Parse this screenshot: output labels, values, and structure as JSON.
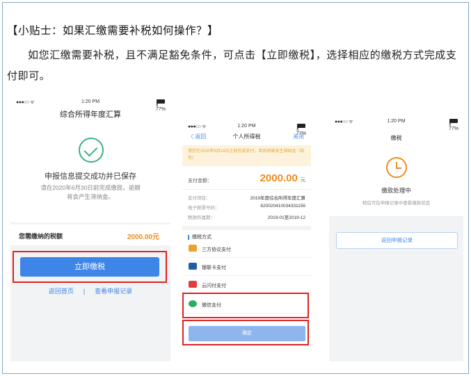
{
  "tip": {
    "title": "【小贴士：如果汇缴需要补税如何操作？】",
    "body": "如您汇缴需要补税，且不满足豁免条件，可点击【立即缴税】，选择相应的缴税方式完成支付即可。"
  },
  "status_bar": {
    "signal": "●●●○○ ᯤ",
    "time": "1:20 PM",
    "battery": "∦ 77%"
  },
  "screen1": {
    "title": "综合所得年度汇算",
    "success_title": "申报信息提交成功并已保存",
    "success_sub": "请在2020年6月30日前完成缴款，逾期将会产生滞纳金。",
    "tax_label": "您需缴纳的税额",
    "tax_amount": "2000.00元",
    "pay_button": "立即缴税",
    "link_home": "返回首页",
    "link_sep": "|",
    "link_records": "查看申报记录"
  },
  "screen2": {
    "back": "〈 返回",
    "title": "个人所得税",
    "close": "关闭",
    "notice": "请您在2020年6月24日之前完成支付，否则将被发生滞纳金（如有）",
    "amount_label": "支付金额：",
    "amount": "2000.00",
    "amount_unit": "元",
    "info": [
      {
        "label": "支付项目：",
        "value": "2019年度综合所得年度汇算"
      },
      {
        "label": "电子税票号码：",
        "value": "620020410034331156"
      },
      {
        "label": "税款所属期：",
        "value": "2019-01至2019-12"
      }
    ],
    "method_header": "缴税方式",
    "methods": [
      {
        "label": "三方协议支付",
        "color": "#f0a030"
      },
      {
        "label": "银联卡支付",
        "color": "#1f5fa8"
      },
      {
        "label": "云闪付支付",
        "color": "#e43c3c"
      },
      {
        "label": "微信支付",
        "color": "#2aae67"
      }
    ],
    "confirm": "确定"
  },
  "screen3": {
    "title": "缴税",
    "status": "缴款处理中",
    "sub": "稍后可在申报记录中查看缴款状态",
    "back_button": "返回申报记录"
  }
}
